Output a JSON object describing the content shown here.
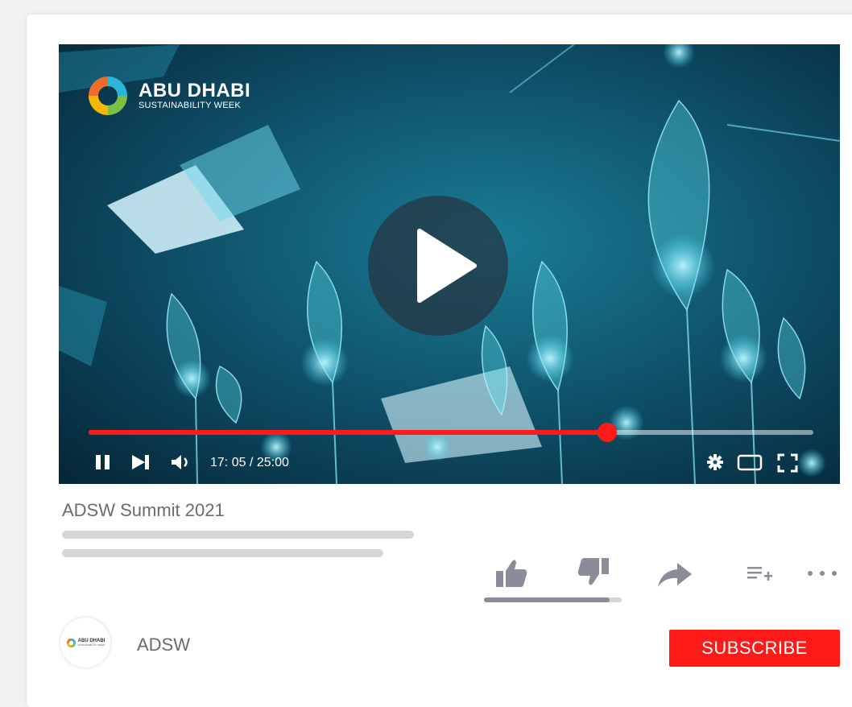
{
  "video": {
    "logo_title": "ABU DHABI",
    "logo_subtitle": "SUSTAINABILITY WEEK",
    "progress_fraction": 0.716,
    "time_display": "17: 05 / 25:00"
  },
  "info": {
    "title": "ADSW Summit 2021"
  },
  "actions": {
    "icons": [
      "thumbs-up-icon",
      "thumbs-down-icon",
      "share-icon",
      "add-to-playlist-icon",
      "more-icon"
    ],
    "like_ratio": 0.91
  },
  "channel": {
    "avatar_title": "ABU DHABI",
    "avatar_subtitle": "SUSTAINABILITY WEEK",
    "name": "ADSW",
    "subscribe_label": "SUBSCRIBE"
  },
  "colors": {
    "accent": "#ff1a1a",
    "video_bg": "#0b3a4e",
    "icon_gray": "#8a8c99",
    "text_gray": "#6b6b6b"
  }
}
